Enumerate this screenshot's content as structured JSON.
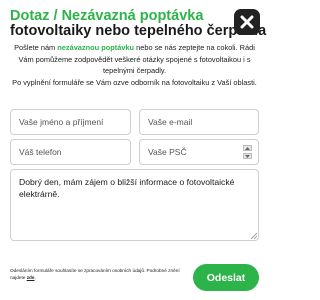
{
  "header": {
    "title_prefix": "Dotaz /",
    "title_highlight": "Nezávazná poptávka",
    "title_line2": "fotovoltaiky nebo tepelného čerpadla"
  },
  "intro": {
    "part1": "Pošlete nám ",
    "highlight": "nezávaznou poptávku",
    "part2": " nebo se nás zeptejte na cokoli. Rádi Vám pomůžeme zodpovědět veškeré otázky spojené s fotovoltaikou i s tepelnými čerpadly.",
    "line2": "Po vyplnění formuláře se Vám ozve odborník na fotovoltaiku z Vaší oblasti."
  },
  "form": {
    "name_placeholder": "Vaše jméno a příjmení",
    "email_placeholder": "Vaše e-mail",
    "phone_placeholder": "Váš telefon",
    "zip_placeholder": "Vaše PSČ",
    "message_value": "Dobrý den, mám zájem o bližší informace o fotovoltaické elektrárně."
  },
  "footer": {
    "consent_text": "Odesláním formuláře souhlasíte se zpracováním osobních údajů. Podrobné znění najdete ",
    "consent_link": "zde",
    "consent_end": ".",
    "submit_label": "Odeslat"
  },
  "colors": {
    "accent": "#2cb34a",
    "close_bg": "#222222"
  },
  "icons": {
    "close": "close-icon",
    "spinner_up": "chevron-up-icon",
    "spinner_down": "chevron-down-icon",
    "resize": "resize-grip-icon"
  }
}
